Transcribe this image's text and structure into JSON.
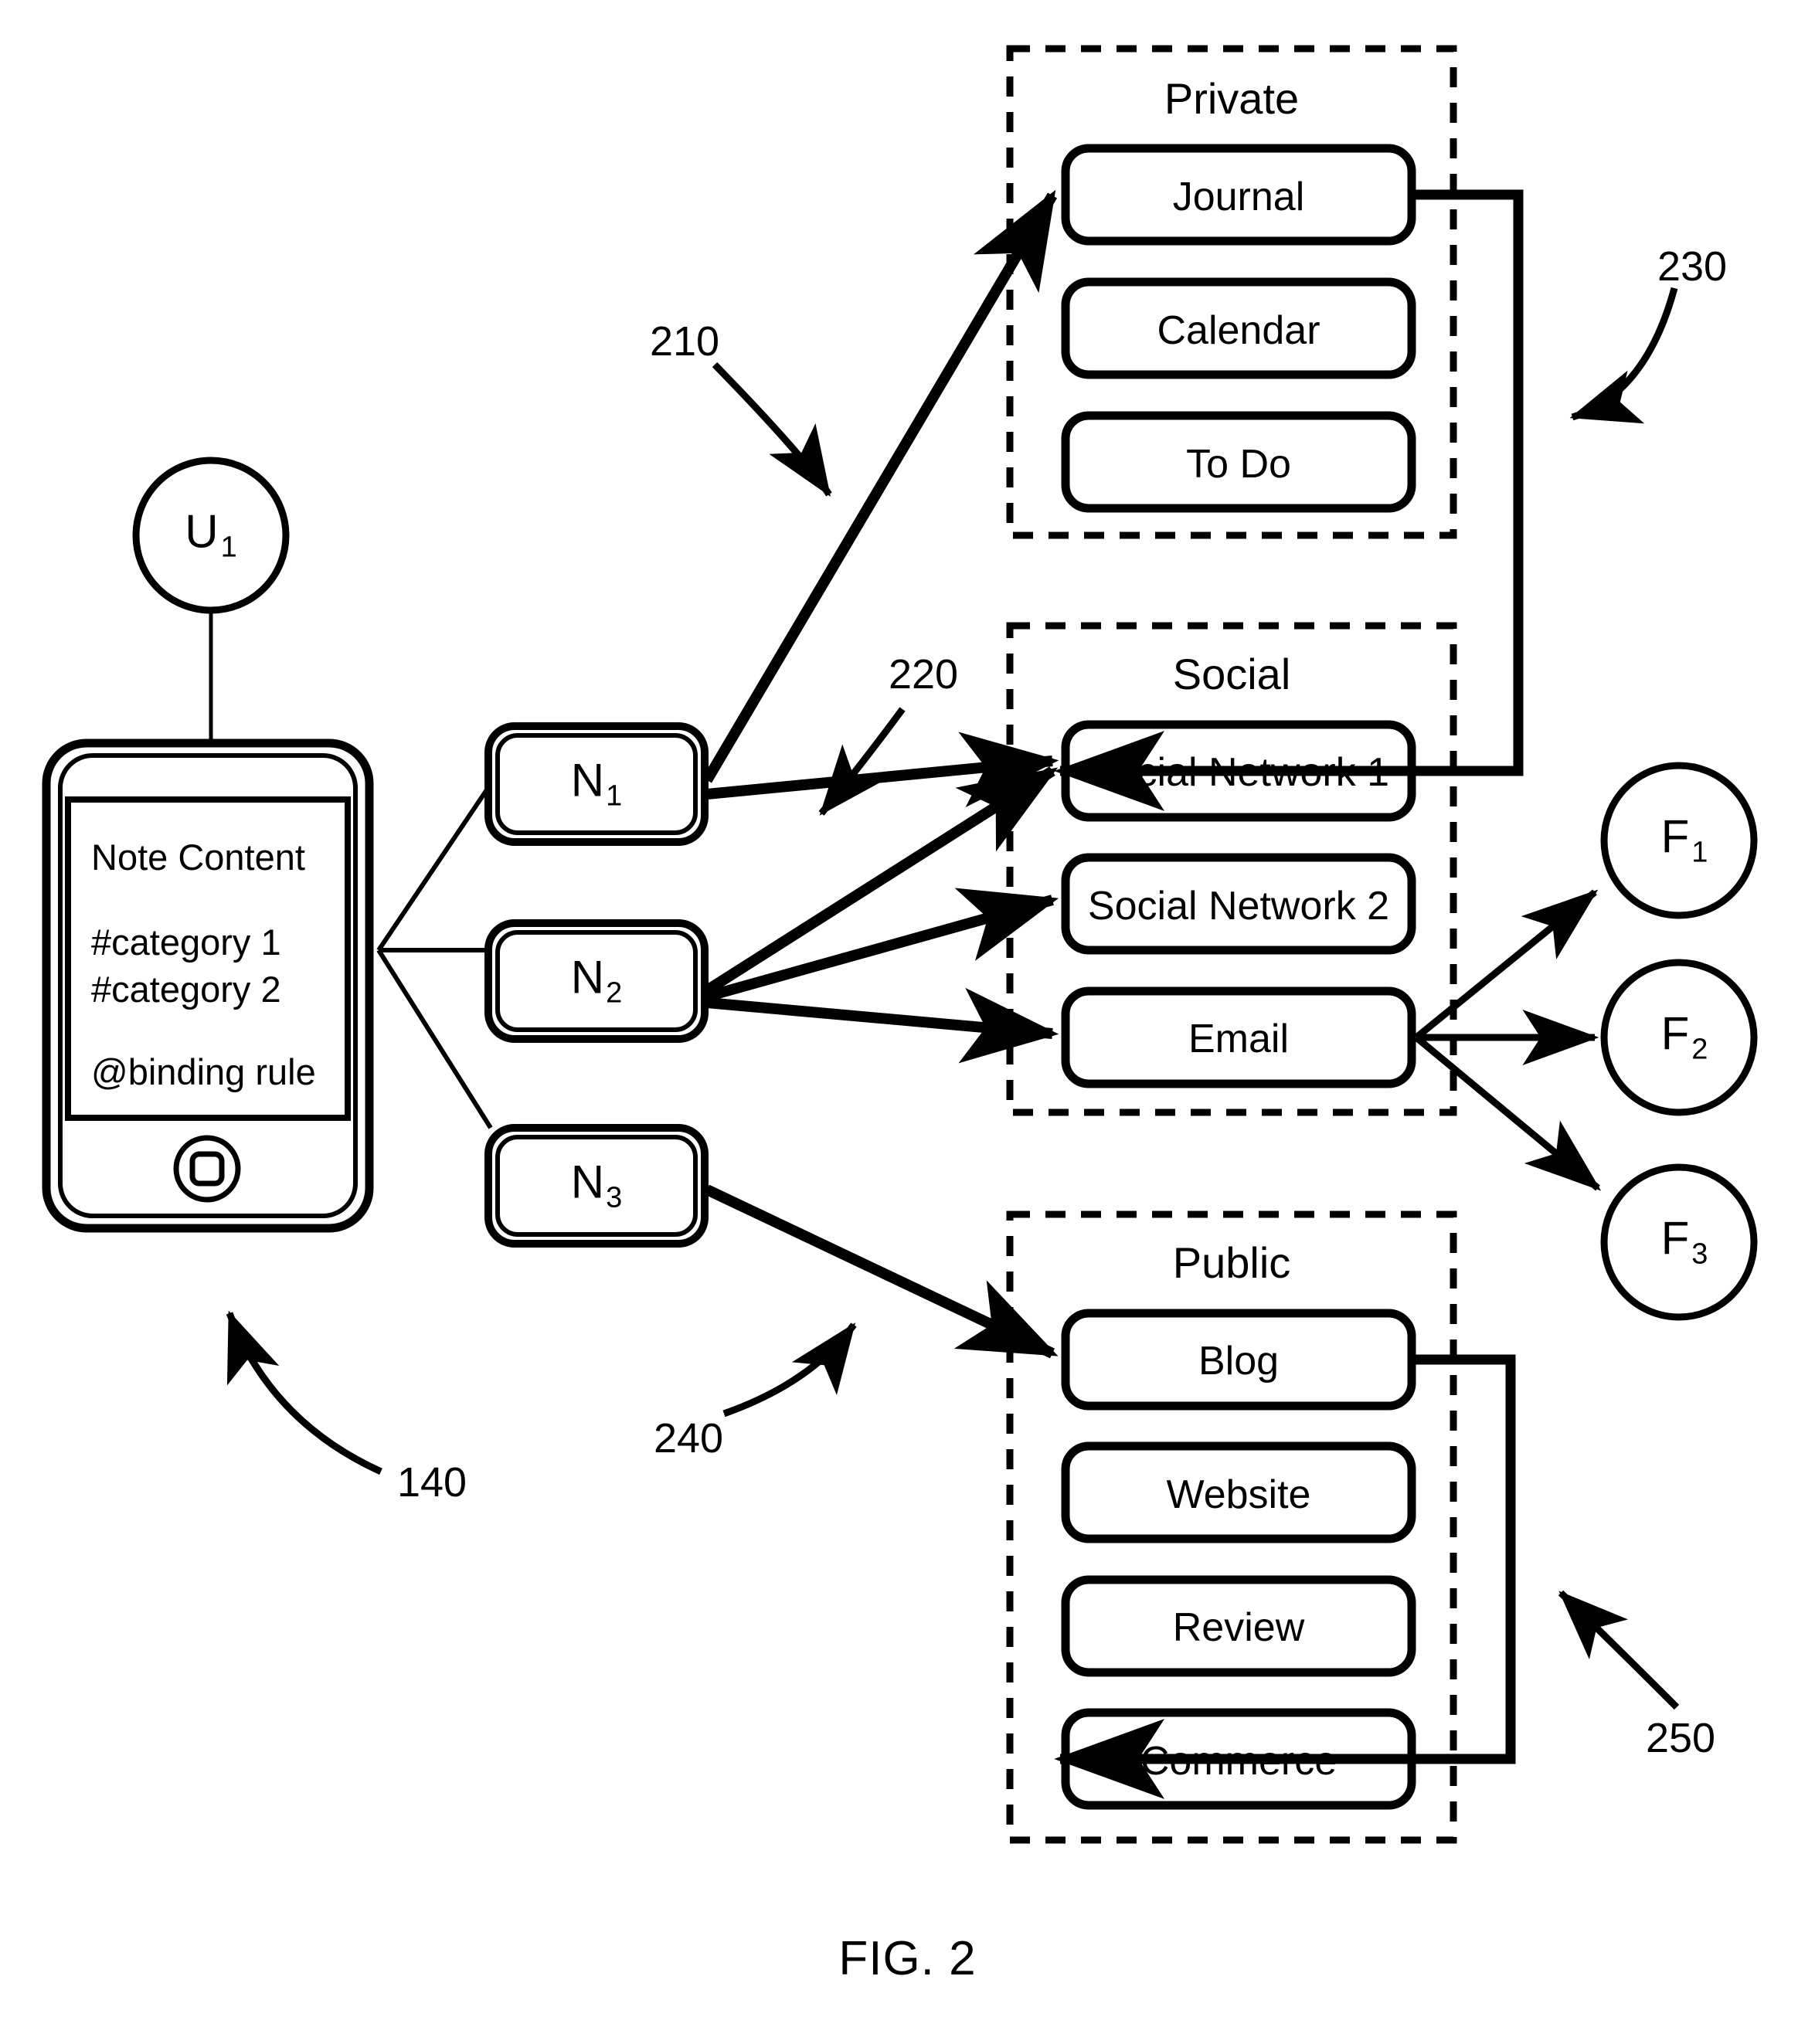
{
  "figure": {
    "caption": "FIG. 2"
  },
  "user": {
    "label": "U",
    "sub": "1",
    "ref": "140"
  },
  "device": {
    "ref": "140",
    "note": {
      "title": "Note Content",
      "tags": [
        "#category 1",
        "#category 2"
      ],
      "rule": "@binding rule"
    }
  },
  "nodes": [
    {
      "label": "N",
      "sub": "1"
    },
    {
      "label": "N",
      "sub": "2"
    },
    {
      "label": "N",
      "sub": "3"
    }
  ],
  "node_refs": {
    "to_private": "210",
    "to_social": "220",
    "to_public": "240"
  },
  "groups": [
    {
      "title": "Private",
      "ref": "230",
      "items": [
        "Journal",
        "Calendar",
        "To Do"
      ]
    },
    {
      "title": "Social",
      "ref": "",
      "items": [
        "Social Network 1",
        "Social Network 2",
        "Email"
      ]
    },
    {
      "title": "Public",
      "ref": "250",
      "items": [
        "Blog",
        "Website",
        "Review",
        "Commerce"
      ]
    }
  ],
  "friends": [
    {
      "label": "F",
      "sub": "1"
    },
    {
      "label": "F",
      "sub": "2"
    },
    {
      "label": "F",
      "sub": "3"
    }
  ],
  "refs": {
    "r140": "140",
    "r210": "210",
    "r220": "220",
    "r230": "230",
    "r240": "240",
    "r250": "250"
  },
  "colors": {
    "line": "#000000",
    "background": "#ffffff"
  }
}
